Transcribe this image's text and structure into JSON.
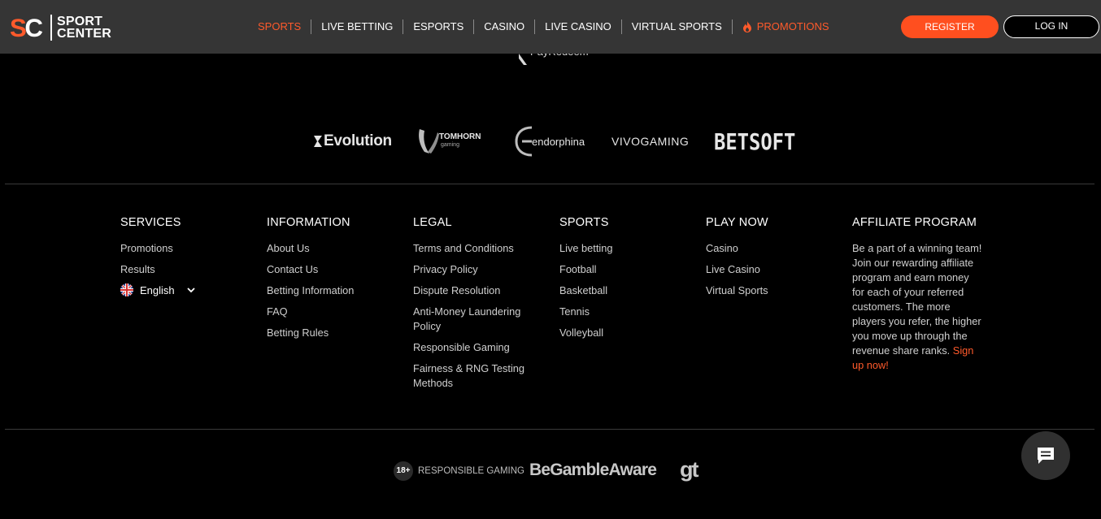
{
  "brand": {
    "line1": "SPORT",
    "line2": "CENTER",
    "accent": "#ff5a2b"
  },
  "nav": {
    "items": [
      {
        "label": "SPORTS",
        "active": true
      },
      {
        "label": "LIVE BETTING"
      },
      {
        "label": "ESPORTS"
      },
      {
        "label": "CASINO"
      },
      {
        "label": "LIVE CASINO"
      },
      {
        "label": "VIRTUAL SPORTS"
      }
    ],
    "promotions": "PROMOTIONS",
    "promotions_icon": "flame-icon"
  },
  "auth": {
    "register": "REGISTER",
    "login": "LOG IN"
  },
  "peek_provider": "PayRedeem",
  "providers": {
    "evolution": "Evolution",
    "tomhorn": "TOMHORN",
    "tomhorn_sub": "gaming",
    "endorphina": "endorphina",
    "vivo": "VIVOGAMING",
    "betsoft": "BETSOFT"
  },
  "footer": {
    "services": {
      "title": "SERVICES",
      "links": [
        "Promotions",
        "Results"
      ],
      "language": "English"
    },
    "information": {
      "title": "INFORMATION",
      "links": [
        "About Us",
        "Contact Us",
        "Betting Information",
        "FAQ",
        "Betting Rules"
      ]
    },
    "legal": {
      "title": "LEGAL",
      "links": [
        "Terms and Conditions",
        "Privacy Policy",
        "Dispute Resolution",
        "Anti-Money Laundering Policy",
        "Responsible Gaming",
        "Fairness & RNG Testing Methods"
      ]
    },
    "sports": {
      "title": "SPORTS",
      "links": [
        "Live betting",
        "Football",
        "Basketball",
        "Tennis",
        "Volleyball"
      ]
    },
    "play_now": {
      "title": "PLAY NOW",
      "links": [
        "Casino",
        "Live Casino",
        "Virtual Sports"
      ]
    },
    "affiliate": {
      "title": "AFFILIATE PROGRAM",
      "text": "Be a part of a winning team! Join our rewarding affiliate program and earn money for each of your referred customers. The more players you refer, the higher you move up through the revenue share ranks.",
      "link": "Sign up now!"
    }
  },
  "bottom": {
    "age": "18+",
    "responsible": "RESPONSIBLE GAMING",
    "gamble_aware": "BeGambleAware",
    "gt": "gt"
  }
}
